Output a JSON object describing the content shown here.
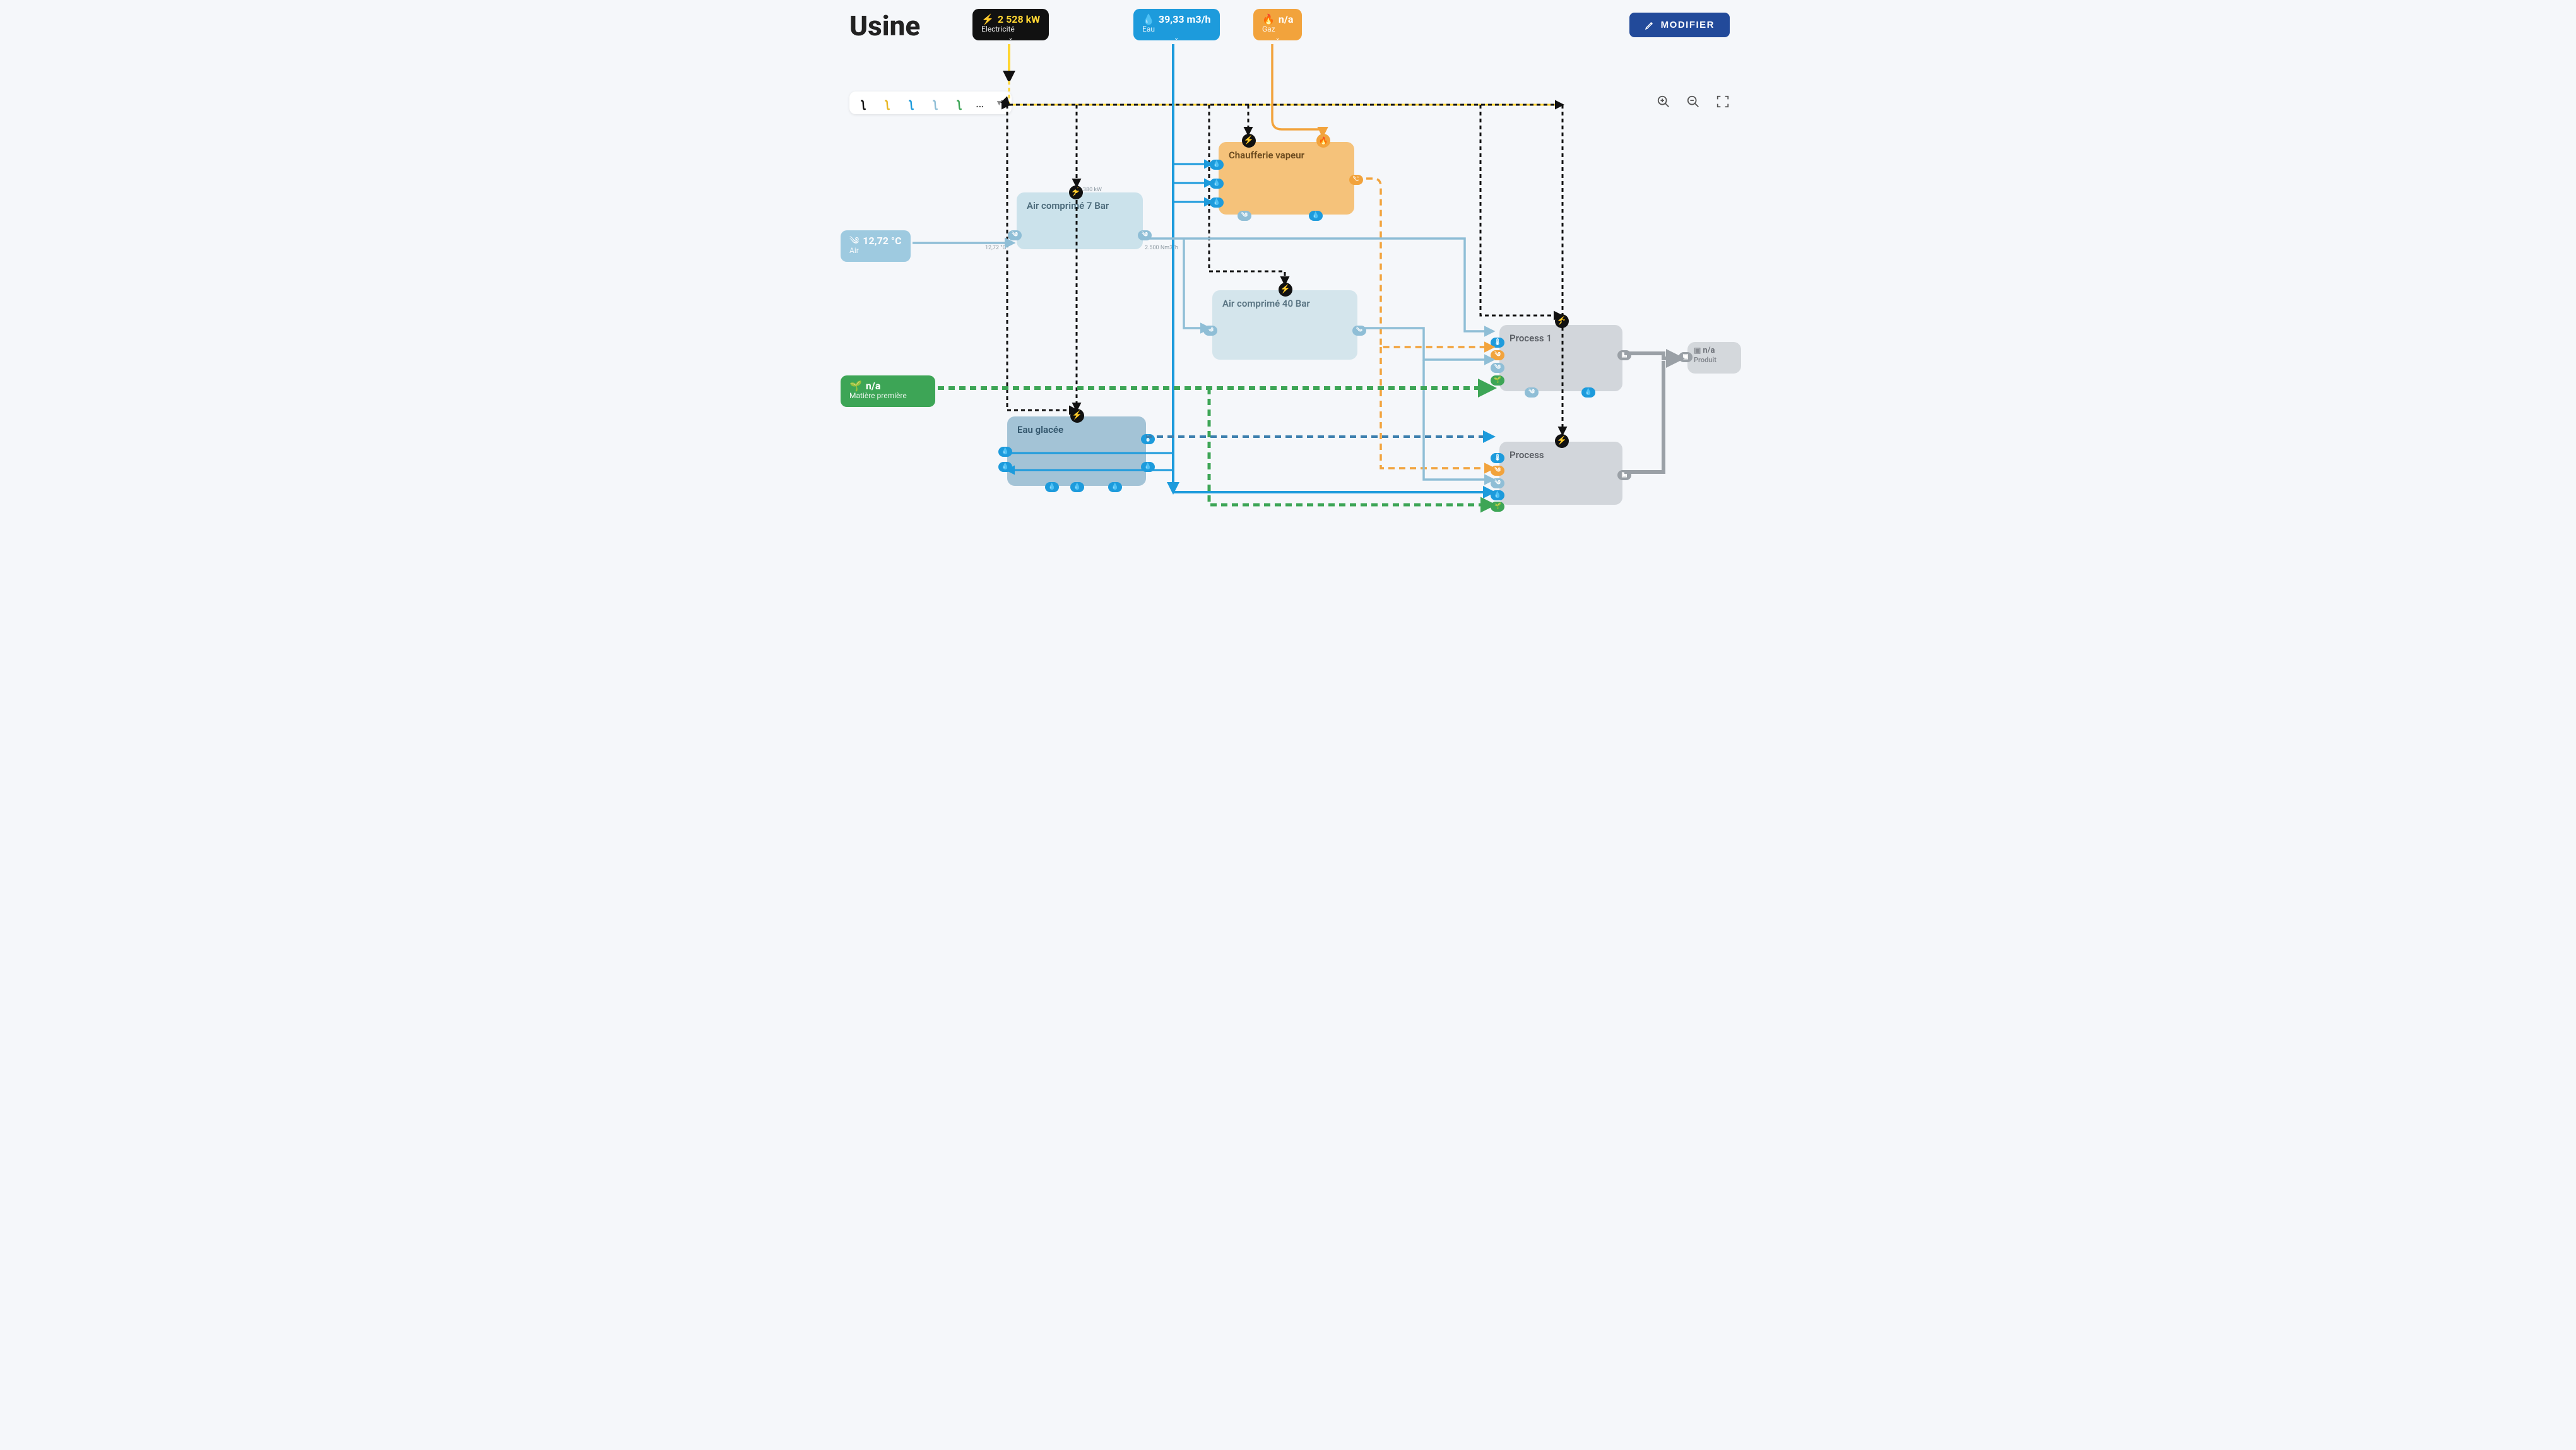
{
  "page_title": "Usine",
  "modifier_label": "MODIFIER",
  "inputs": {
    "electricity": {
      "value": "2 528 kW",
      "label": "Electricité",
      "icon": "⚡"
    },
    "water": {
      "value": "39,33 m3/h",
      "label": "Eau",
      "icon": "💧"
    },
    "gas": {
      "value": "n/a",
      "label": "Gaz",
      "icon": "🔥"
    },
    "air": {
      "value": "12,72 °C",
      "label": "Air",
      "icon": "༄"
    },
    "raw": {
      "value": "n/a",
      "label": "Matière première",
      "icon": "🌱"
    }
  },
  "nodes": {
    "air7": {
      "label": "Air comprimé 7 Bar"
    },
    "steam": {
      "label": "Chaufferie vapeur"
    },
    "air40": {
      "label": "Air comprimé 40 Bar"
    },
    "ice": {
      "label": "Eau glacée"
    },
    "proc1": {
      "label": "Process 1"
    },
    "proc": {
      "label": "Process"
    },
    "product": {
      "value": "n/a",
      "label": "Produit"
    }
  },
  "annotations": {
    "air7_top": "380 kW",
    "air7_left": "12,72 °C",
    "air7_right": "2.500 Nm3/h"
  },
  "colors": {
    "electricity": "#111111",
    "electricity_accent": "#ffd633",
    "water": "#1d9bdc",
    "gas": "#f2a33c",
    "air": "#7ab8d6",
    "raw": "#3da556",
    "steam": "#f5c27a",
    "ice": "#a3c3d6",
    "process": "#d2d6db"
  }
}
